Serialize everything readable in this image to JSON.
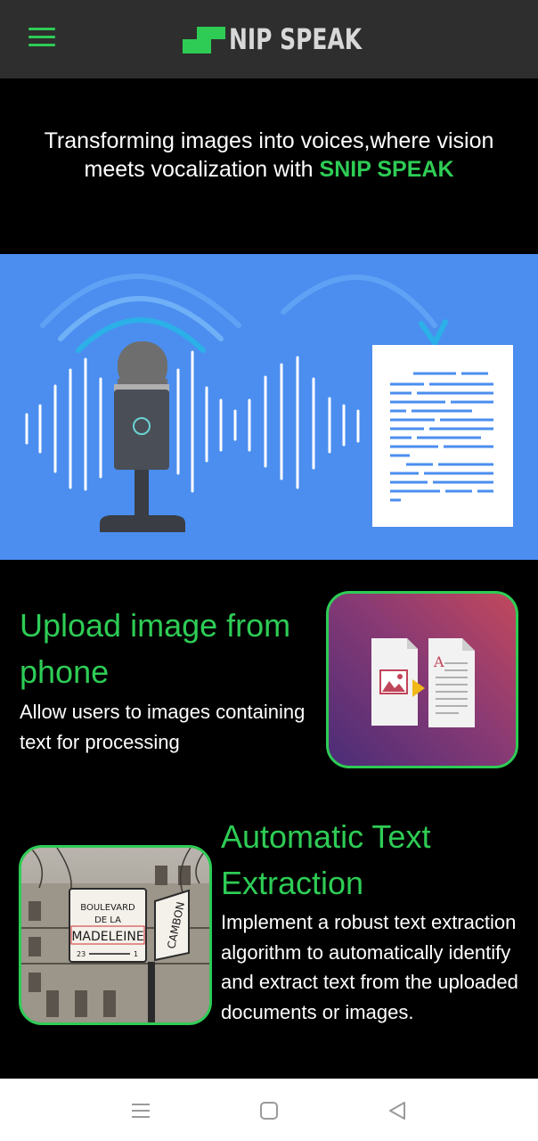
{
  "header": {
    "menu_icon": "hamburger-menu-icon",
    "logo_text": "NIP SPEAK",
    "accent_color": "#2ecc55",
    "bar_color": "#2e2e2e"
  },
  "hero": {
    "tagline": "Transforming images into voices,where vision meets vocalization with",
    "brand": "SNIP SPEAK"
  },
  "banner": {
    "background": "#4b8eef",
    "illustration": "microphone-to-document-illustration"
  },
  "features": [
    {
      "title": "Upload image from phone",
      "description": "Allow users to images containing text for processing",
      "icon": "image-to-document-icon"
    },
    {
      "title": "Automatic Text Extraction",
      "description": "Implement a robust text extraction algorithm to automatically identify and extract text from the uploaded documents or images.",
      "image": "street-sign-photo"
    }
  ],
  "street_sign": {
    "line1": "BOULEVARD",
    "line2": "DE LA",
    "line3": "MADELEINE",
    "number_left": "23",
    "number_right": "1",
    "side_sign": "CAMBON"
  },
  "system_nav": {
    "recents_icon": "recents-icon",
    "home_icon": "home-icon",
    "back_icon": "back-icon"
  }
}
